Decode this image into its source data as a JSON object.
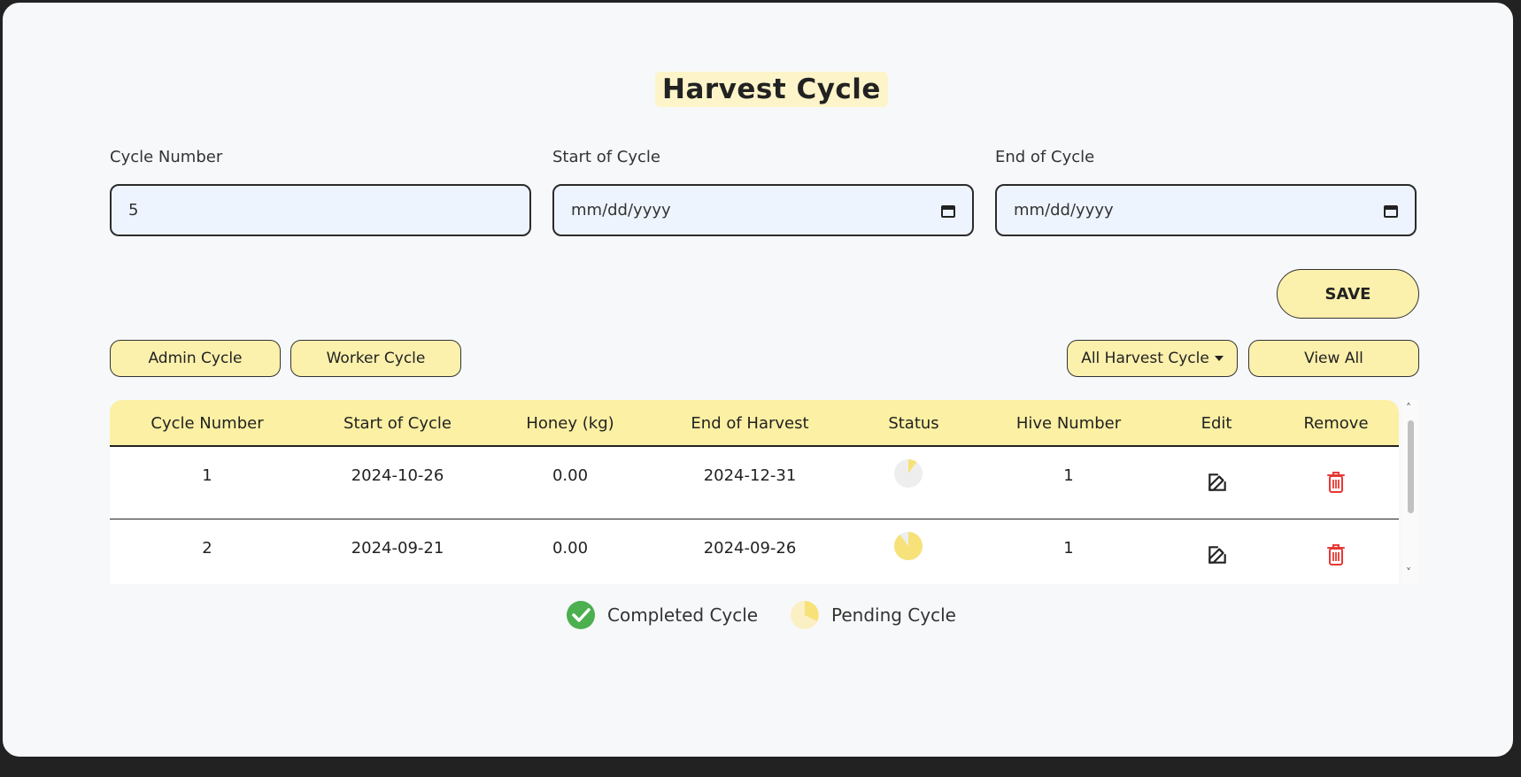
{
  "page": {
    "title": "Harvest Cycle"
  },
  "form": {
    "cycle_number_label": "Cycle Number",
    "cycle_number_value": "5",
    "start_label": "Start of Cycle",
    "start_value": "mm/dd/yyyy",
    "end_label": "End of Cycle",
    "end_value": "mm/dd/yyyy",
    "save_label": "SAVE"
  },
  "filters": {
    "admin_label": "Admin Cycle",
    "worker_label": "Worker Cycle",
    "dropdown_label": "All Harvest Cycle",
    "view_all_label": "View All"
  },
  "table": {
    "headers": [
      "Cycle Number",
      "Start of Cycle",
      "Honey (kg)",
      "End of Harvest",
      "Status",
      "Hive Number",
      "Edit",
      "Remove"
    ],
    "rows": [
      {
        "cycle": "1",
        "start": "2024-10-26",
        "honey": "0.00",
        "end": "2024-12-31",
        "status": "pending",
        "status_progress": 0.1,
        "hive": "1"
      },
      {
        "cycle": "2",
        "start": "2024-09-21",
        "honey": "0.00",
        "end": "2024-09-26",
        "status": "pending",
        "status_progress": 0.9,
        "hive": "1"
      }
    ]
  },
  "legend": {
    "completed_label": "Completed Cycle",
    "pending_label": "Pending Cycle"
  },
  "colors": {
    "accent": "#fbf0ac",
    "header": "#fbf0a3",
    "completed": "#4caf50",
    "pending": "#f7e27a",
    "remove": "#e53935"
  }
}
